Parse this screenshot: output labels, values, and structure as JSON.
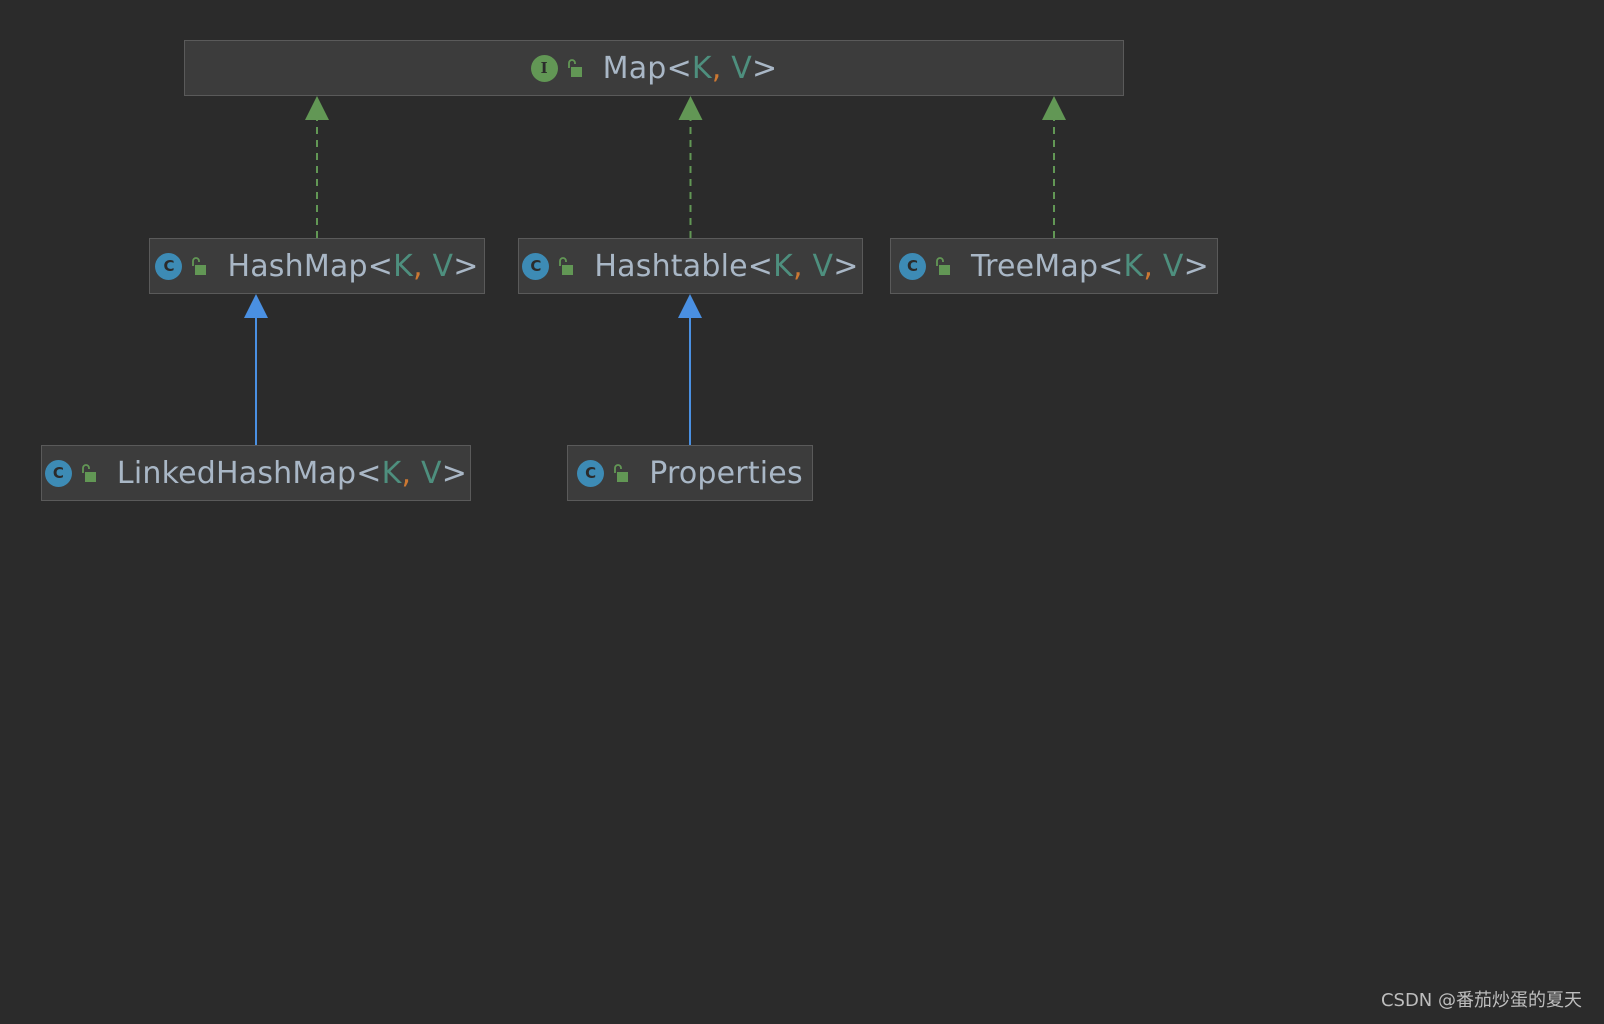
{
  "diagram": {
    "nodes": [
      {
        "id": "map",
        "kind": "interface",
        "kind_letter": "I",
        "name": "Map",
        "generic": {
          "open": "<",
          "p1": "K",
          "comma": ",",
          "p2": "V",
          "close": ">"
        }
      },
      {
        "id": "hashmap",
        "kind": "class",
        "kind_letter": "C",
        "name": "HashMap",
        "generic": {
          "open": "<",
          "p1": "K",
          "comma": ",",
          "p2": "V",
          "close": ">"
        }
      },
      {
        "id": "hashtable",
        "kind": "class",
        "kind_letter": "C",
        "name": "Hashtable",
        "generic": {
          "open": "<",
          "p1": "K",
          "comma": ",",
          "p2": "V",
          "close": ">"
        }
      },
      {
        "id": "treemap",
        "kind": "class",
        "kind_letter": "C",
        "name": "TreeMap",
        "generic": {
          "open": "<",
          "p1": "K",
          "comma": ",",
          "p2": "V",
          "close": ">"
        }
      },
      {
        "id": "linkedhashmap",
        "kind": "class",
        "kind_letter": "C",
        "name": "LinkedHashMap",
        "generic": {
          "open": "<",
          "p1": "K",
          "comma": ",",
          "p2": "V",
          "close": ">"
        }
      },
      {
        "id": "properties",
        "kind": "class",
        "kind_letter": "C",
        "name": "Properties"
      }
    ],
    "edges": [
      {
        "from": "hashmap",
        "to": "map",
        "type": "implements"
      },
      {
        "from": "hashtable",
        "to": "map",
        "type": "implements"
      },
      {
        "from": "treemap",
        "to": "map",
        "type": "implements"
      },
      {
        "from": "linkedhashmap",
        "to": "hashmap",
        "type": "extends"
      },
      {
        "from": "properties",
        "to": "hashtable",
        "type": "extends"
      }
    ]
  },
  "colors": {
    "background": "#2b2b2b",
    "node_fill": "#3c3c3c",
    "node_border": "#5a5a5a",
    "text": "#a9b7c6",
    "type_param": "#4e8f7e",
    "comma": "#cc7832",
    "implements_edge": "#629755",
    "extends_edge": "#4a90e2",
    "interface_icon": "#629755",
    "class_icon": "#3d8bb5",
    "access_icon": "#629755"
  },
  "icons": {
    "interface": "interface-icon",
    "class": "class-icon",
    "access": "public-access-icon"
  },
  "watermark": "CSDN @番茄炒蛋的夏天"
}
